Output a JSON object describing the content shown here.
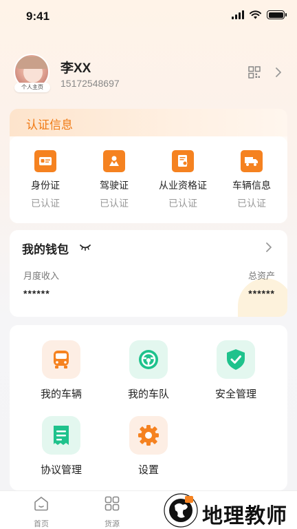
{
  "status_bar": {
    "time": "9:41"
  },
  "profile": {
    "name": "李XX",
    "phone": "15172548697",
    "avatar_badge": "个人主页"
  },
  "certification": {
    "title": "认证信息",
    "accent": "#f58220",
    "items": [
      {
        "label": "身份证",
        "status": "已认证",
        "icon": "id-card-icon"
      },
      {
        "label": "驾驶证",
        "status": "已认证",
        "icon": "driver-license-icon"
      },
      {
        "label": "从业资格证",
        "status": "已认证",
        "icon": "qualification-cert-icon"
      },
      {
        "label": "车辆信息",
        "status": "已认证",
        "icon": "truck-icon"
      }
    ]
  },
  "wallet": {
    "title": "我的钱包",
    "monthly_income_label": "月度收入",
    "total_assets_label": "总资产",
    "monthly_income_value": "******",
    "total_assets_value": "******"
  },
  "features": {
    "items": [
      {
        "label": "我的车辆",
        "icon": "bus-icon"
      },
      {
        "label": "我的车队",
        "icon": "steering-wheel-icon"
      },
      {
        "label": "安全管理",
        "icon": "shield-check-icon"
      },
      {
        "label": "协议管理",
        "icon": "document-icon"
      },
      {
        "label": "设置",
        "icon": "gear-icon"
      }
    ]
  },
  "tab_bar": {
    "items": [
      {
        "label": "首页",
        "icon": "home-icon"
      },
      {
        "label": "货源",
        "icon": "grid-icon"
      }
    ]
  },
  "watermark": {
    "text": "地理教师"
  },
  "colors": {
    "orange": "#f58220",
    "title_orange": "#f07a14",
    "green": "#1fc28c",
    "green_bg": "#e3f7ef",
    "orange_bg": "#fdeee4"
  }
}
